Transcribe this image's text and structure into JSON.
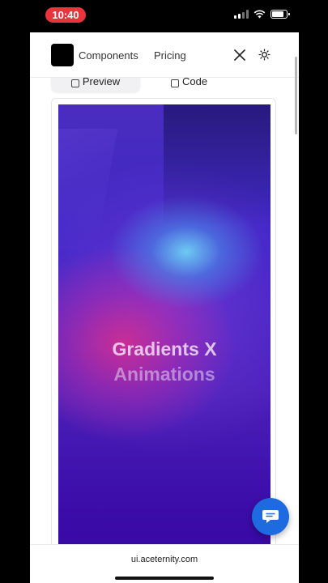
{
  "status_bar": {
    "time": "10:40"
  },
  "nav": {
    "links": [
      "Components",
      "Pricing"
    ],
    "icons": [
      "x-logo-icon",
      "sun-theme-icon"
    ]
  },
  "tabs": {
    "preview": "Preview",
    "code": "Code"
  },
  "preview": {
    "line1": "Gradients X",
    "line2": "Animations"
  },
  "browser": {
    "url": "ui.aceternity.com"
  },
  "colors": {
    "time_pill": "#e8353b",
    "chat_fab": "#1e6ae0",
    "gradient_base": "#3d26c4",
    "gradient_pink": "#dc2d8c",
    "gradient_cyan": "#6ed2f5"
  }
}
